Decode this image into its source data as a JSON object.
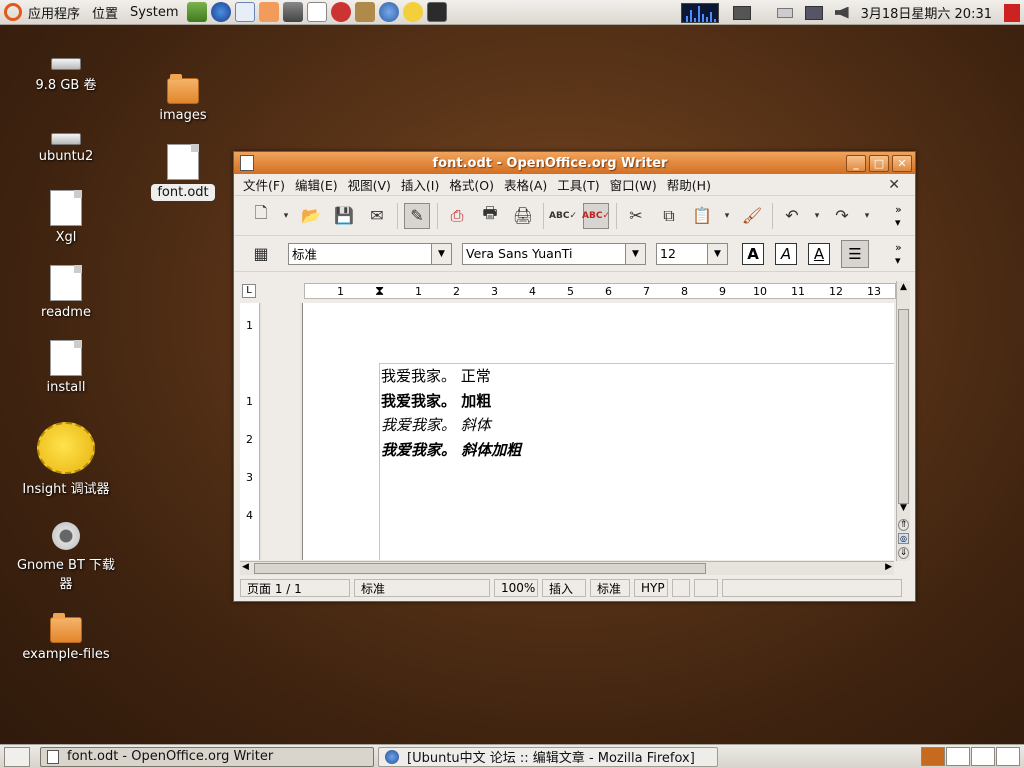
{
  "top_panel": {
    "applications": "应用程序",
    "places": "位置",
    "system": "System",
    "clock": "3月18日星期六 20:31"
  },
  "desktop": {
    "icons": [
      {
        "label": "9.8 GB 卷",
        "type": "drive"
      },
      {
        "label": "ubuntu2",
        "type": "drive"
      },
      {
        "label": "Xgl",
        "type": "document"
      },
      {
        "label": "readme",
        "type": "document"
      },
      {
        "label": "install",
        "type": "document"
      },
      {
        "label": "Insight 调试器",
        "type": "application"
      },
      {
        "label": "Gnome BT 下载器",
        "type": "application"
      },
      {
        "label": "example-files",
        "type": "folder"
      },
      {
        "label": "images",
        "type": "folder"
      },
      {
        "label": "font.odt",
        "type": "odt-document"
      }
    ]
  },
  "window": {
    "title": "font.odt - OpenOffice.org Writer",
    "menu": [
      "文件(F)",
      "编辑(E)",
      "视图(V)",
      "插入(I)",
      "格式(O)",
      "表格(A)",
      "工具(T)",
      "窗口(W)",
      "帮助(H)"
    ],
    "format": {
      "paragraph_style": "标准",
      "font_name": "Vera Sans YuanTi",
      "font_size": "12",
      "bold_label": "A",
      "italic_label": "A",
      "underline_label": "A"
    },
    "ruler_numbers": [
      "1",
      "1",
      "2",
      "3",
      "4",
      "5",
      "6",
      "7",
      "8",
      "9",
      "10",
      "11",
      "12",
      "13"
    ],
    "vruler_numbers": [
      "1",
      "1",
      "2",
      "3",
      "4"
    ],
    "document_lines": [
      {
        "text": "我爱我家。 正常",
        "style": "normal"
      },
      {
        "text": "我爱我家。 加粗",
        "style": "bold"
      },
      {
        "text": "我爱我家。 斜体",
        "style": "italic"
      },
      {
        "text": "我爱我家。 斜体加粗",
        "style": "bold-italic"
      }
    ],
    "status": {
      "page": "页面 1 / 1",
      "style": "标准",
      "zoom": "100%",
      "insert_mode": "插入",
      "selection_mode": "标准",
      "hyphenation": "HYP"
    }
  },
  "taskbar": {
    "tasks": [
      {
        "label": "font.odt - OpenOffice.org Writer",
        "active": true
      },
      {
        "label": "[Ubuntu中文 论坛 :: 编辑文章 - Mozilla Firefox]",
        "active": false
      }
    ]
  }
}
